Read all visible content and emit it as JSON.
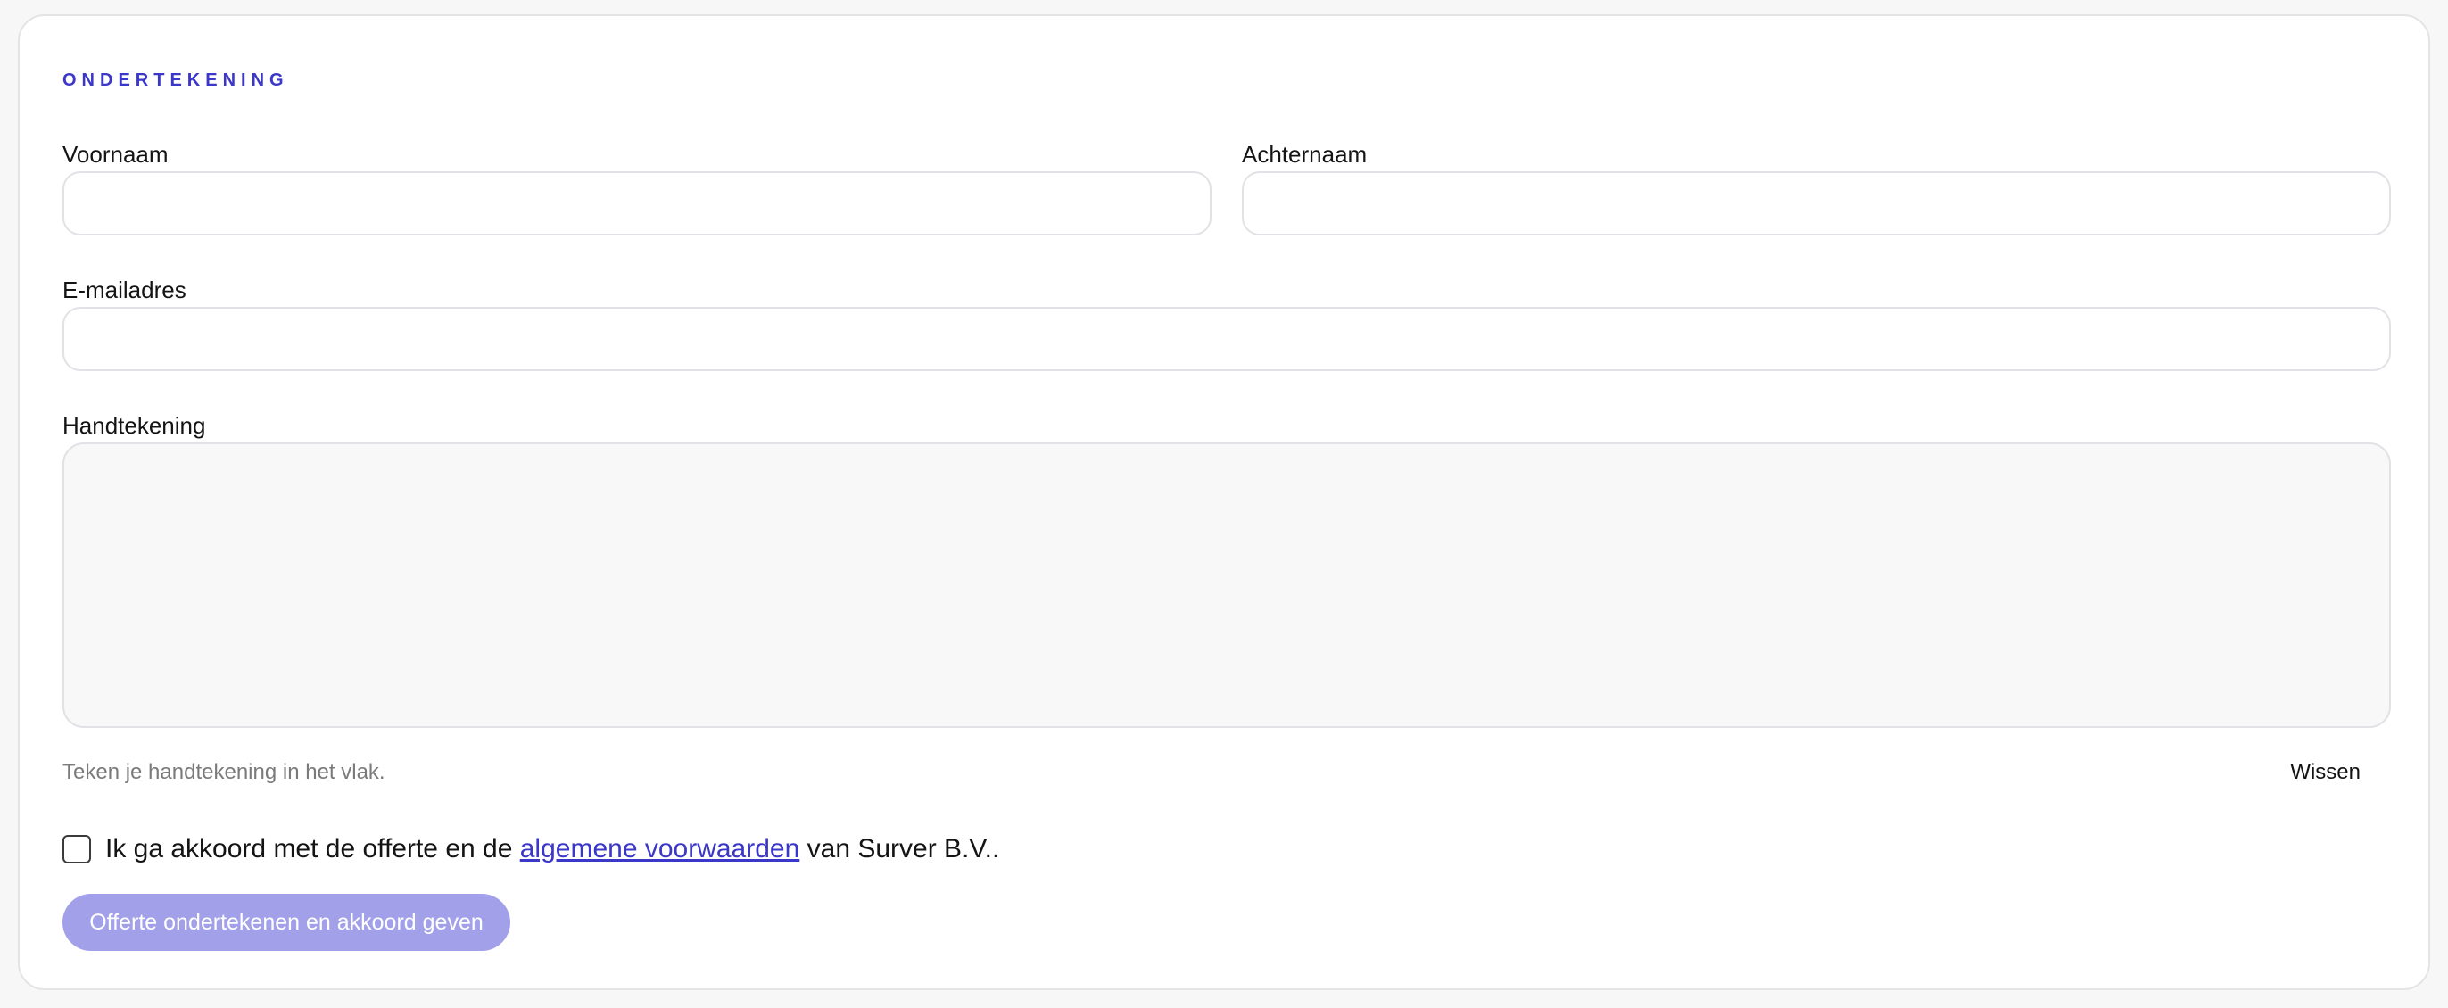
{
  "signature_section": {
    "title": "ONDERTEKENING",
    "first_name_label": "Voornaam",
    "first_name_value": "",
    "last_name_label": "Achternaam",
    "last_name_value": "",
    "email_label": "E-mailadres",
    "email_value": "",
    "signature_label": "Handtekening",
    "signature_hint": "Teken je handtekening in het vlak.",
    "clear_label": "Wissen",
    "consent_prefix": "Ik ga akkoord met de offerte en de ",
    "consent_link": "algemene voorwaarden",
    "consent_suffix": " van Surver B.V..",
    "consent_checked": false,
    "submit_label": "Offerte ondertekenen en akkoord geven"
  },
  "colors": {
    "accent": "#3b37c8",
    "button_disabled": "#a2a0e8",
    "page_background": "#f7f7f7",
    "signature_pad": "#f8f8f8"
  }
}
